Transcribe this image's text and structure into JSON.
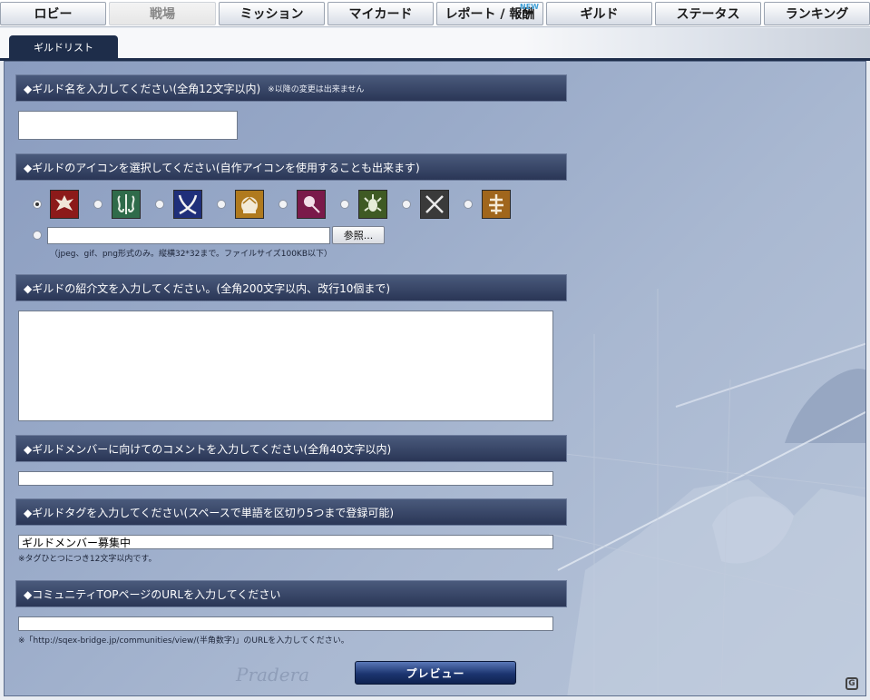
{
  "nav": {
    "tabs": [
      {
        "label": "ロビー"
      },
      {
        "label": "戦場"
      },
      {
        "label": "ミッション"
      },
      {
        "label": "マイカード"
      },
      {
        "label": "レポート / 報酬",
        "badge": "NEW"
      },
      {
        "label": "ギルド"
      },
      {
        "label": "ステータス"
      },
      {
        "label": "ランキング"
      }
    ],
    "active_tab": "戦場"
  },
  "subnav": {
    "tab_label": "ギルドリスト"
  },
  "form": {
    "guild_name": {
      "heading": "◆ギルド名を入力してください(全角12文字以内)",
      "note": "※以降の変更は出来ません",
      "value": ""
    },
    "guild_icon": {
      "heading": "◆ギルドのアイコンを選択してください(自作アイコンを使用することも出来ます)",
      "icons": [
        {
          "name": "eagle-crest-icon",
          "bg": "#8c1a1a"
        },
        {
          "name": "seahorse-crest-icon",
          "bg": "#2f6b4a"
        },
        {
          "name": "crossed-swords-icon",
          "bg": "#1f2f7a"
        },
        {
          "name": "crown-icon",
          "bg": "#b07a1e"
        },
        {
          "name": "rose-icon",
          "bg": "#7a1a4a"
        },
        {
          "name": "scorpion-icon",
          "bg": "#3f5a24"
        },
        {
          "name": "crossed-blades-icon",
          "bg": "#3a3a3a"
        },
        {
          "name": "tree-crest-icon",
          "bg": "#a0661c"
        }
      ],
      "selected_index": 0,
      "file_value": "",
      "browse_label": "参照...",
      "hint": "（jpeg、gif、png形式のみ。縦横32*32まで。ファイルサイズ100KB以下）"
    },
    "intro": {
      "heading": "◆ギルドの紹介文を入力してください。(全角200文字以内、改行10個まで)",
      "value": ""
    },
    "member_comment": {
      "heading": "◆ギルドメンバーに向けてのコメントを入力してください(全角40文字以内)",
      "value": ""
    },
    "tags": {
      "heading": "◆ギルドタグを入力してください(スペースで単語を区切り5つまで登録可能)",
      "value": "ギルドメンバー募集中",
      "hint": "※タグひとつにつき12文字以内です。"
    },
    "community_url": {
      "heading": "◆コミュニティTOPページのURLを入力してください",
      "value": "",
      "hint": "※「http://sqex-bridge.jp/communities/view/(半角数字)」のURLを入力してください。"
    },
    "preview_label": "プレビュー"
  },
  "watermark_text": "Pradera",
  "corner_logo": "G",
  "colors": {
    "nav_dark": "#1e2d4a",
    "panel_bg": "#9aabc9",
    "section_head": "#2a3656"
  }
}
